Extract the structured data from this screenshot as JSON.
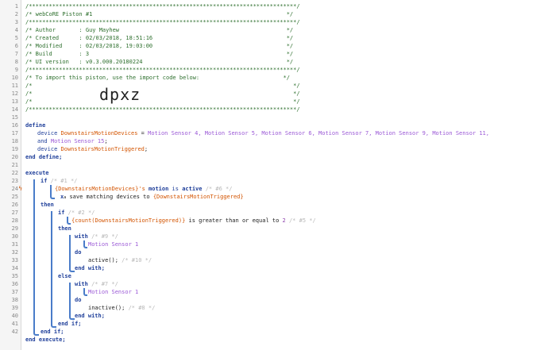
{
  "lines": [
    "/********************************************************************************/",
    "/* webCoRE Piston #1                                                          */",
    "/********************************************************************************/",
    "/* Author       : Guy Mayhew                                                  */",
    "/* Created      : 02/03/2018, 18:51:16                                        */",
    "/* Modified     : 02/03/2018, 19:03:00                                        */",
    "/* Build        : 3                                                           */",
    "/* UI version   : v0.3.000.20180224                                           */",
    "/********************************************************************************/",
    "/* To import this piston, use the import code below:                         */",
    "/*                                                                              */",
    "/*                                                                              */",
    "/*                                                                              */",
    "/********************************************************************************/"
  ],
  "import_code": "dpxz",
  "code": {
    "define": "define",
    "device_kw": "device",
    "motion_var": "DownstairsMotionDevices",
    "eq": " = ",
    "devices_list": "Motion Sensor 4, Motion Sensor 5, Motion Sensor 6, Motion Sensor 7, Motion Sensor 9, Motion Sensor 11,",
    "and_kw": "and",
    "last_dev": "Motion Sensor 15",
    "semi": ";",
    "trig_var": "DownstairsMotionTriggered",
    "end_define": "end define;",
    "execute": "execute",
    "if": "if",
    "c1": "/* #1 */",
    "cond1_open": "{",
    "cond1_close": "}'s",
    "motion_attr": "motion",
    "is_kw": "is",
    "active_val": "active",
    "c6": "/* #6 */",
    "x": "x",
    "save_text": "save matching devices to",
    "save_var": "{DownstairsMotionTriggered}",
    "then": "then",
    "c2": "/* #2 */",
    "count_expr": "{count(DownstairsMotionTriggered)}",
    "gte_text": "is greater than or equal to",
    "two": "2",
    "c5": "/* #5 */",
    "with": "with",
    "c9": "/* #9 */",
    "motion1": "Motion Sensor 1",
    "do": "do",
    "active_cmd": "active();",
    "c10": "/* #10 */",
    "end_with": "end with;",
    "else": "else",
    "c7": "/* #7 */",
    "inactive_cmd": "inactive();",
    "c8": "/* #8 */",
    "end_if": "end if;",
    "end_execute": "end execute;"
  },
  "line_numbers": [
    "1",
    "2",
    "3",
    "4",
    "5",
    "6",
    "7",
    "8",
    "9",
    "10",
    "11",
    "12",
    "13",
    "14",
    "15",
    "16",
    "17",
    "18",
    "19",
    "20",
    "21",
    "22",
    "23",
    "24",
    "25",
    "26",
    "27",
    "28",
    "29",
    "30",
    "31",
    "32",
    "33",
    "34",
    "35",
    "36",
    "37",
    "38",
    "39",
    "40",
    "41",
    "42"
  ],
  "trigger_icon": "lightning-bolt-icon",
  "colors": {
    "keyword": "#1f3f9a",
    "device": "#9b59d6",
    "variable": "#d35400",
    "comment": "#b8b8b8",
    "header": "#2d6f2d",
    "bracket": "#4a7cc9"
  }
}
